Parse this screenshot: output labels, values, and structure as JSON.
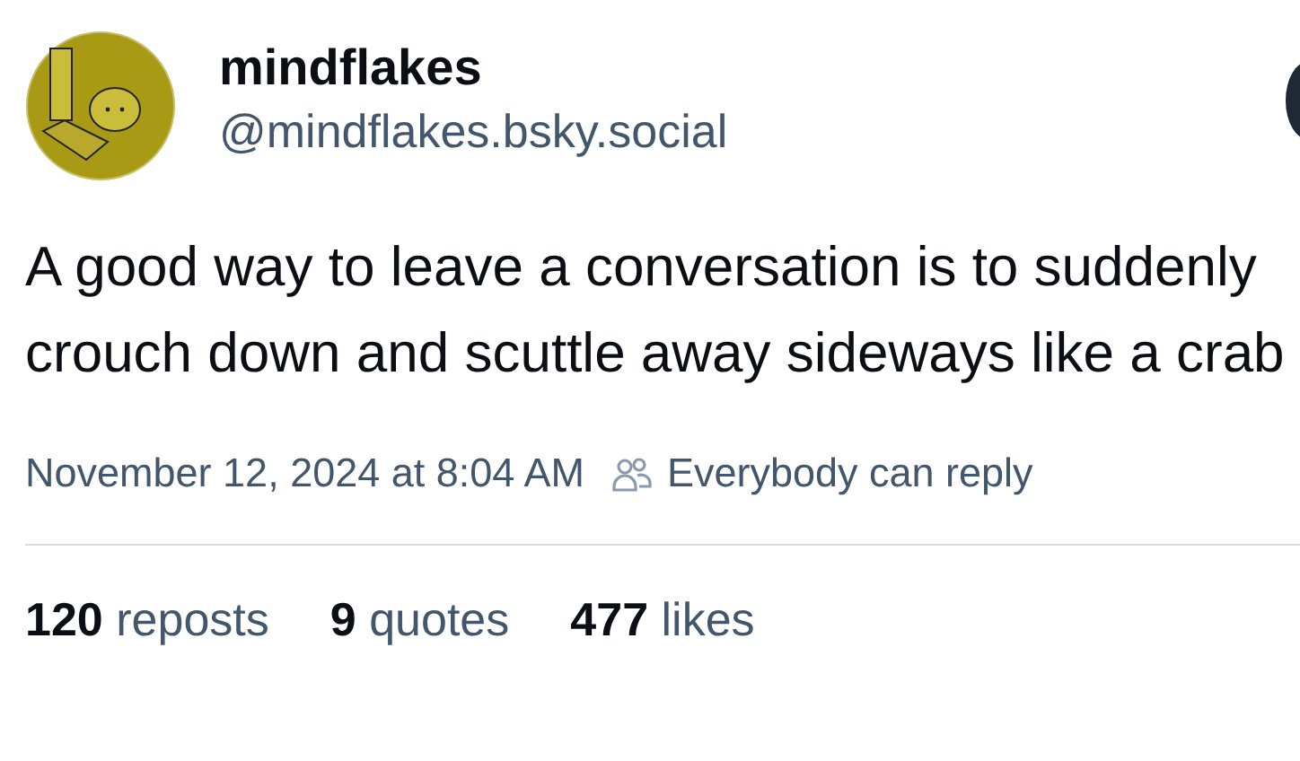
{
  "author": {
    "display_name": "mindflakes",
    "handle": "@mindflakes.bsky.social"
  },
  "post": {
    "text": "A good way to leave a conversation is to suddenly crouch down and scuttle away sideways like a crab",
    "timestamp": "November 12, 2024 at 8:04 AM",
    "reply_setting": "Everybody can reply"
  },
  "stats": [
    {
      "count": "120",
      "label": "reposts"
    },
    {
      "count": "9",
      "label": "quotes"
    },
    {
      "count": "477",
      "label": "likes"
    }
  ]
}
